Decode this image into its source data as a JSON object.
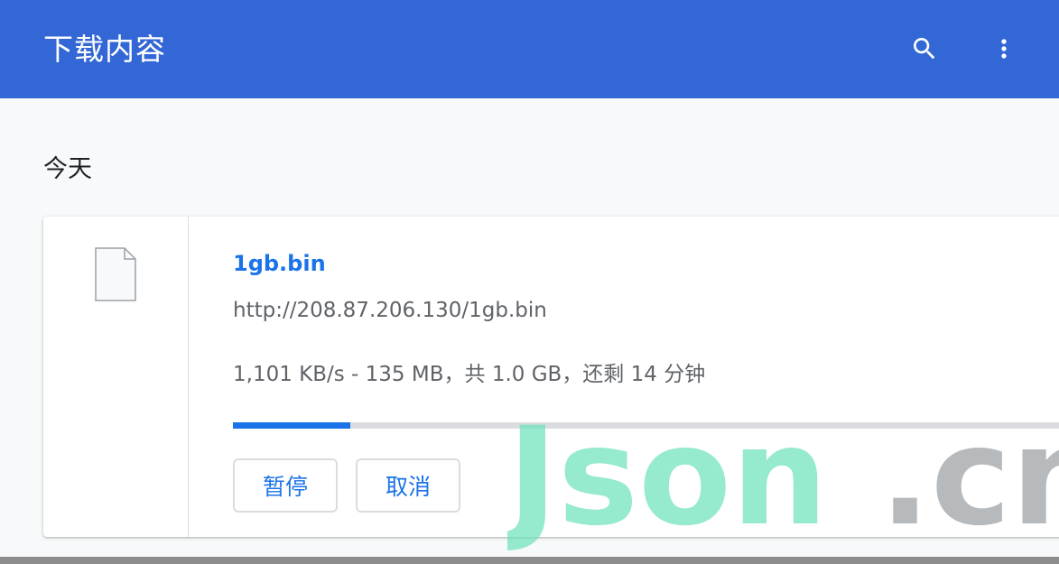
{
  "header": {
    "title": "下载内容",
    "search_icon": "search-icon",
    "more_icon": "more-vert-icon",
    "background_color": "#3367d6"
  },
  "section": {
    "date_label": "今天"
  },
  "download": {
    "file_icon": "file-icon",
    "file_name": "1gb.bin",
    "url": "http://208.87.206.130/1gb.bin",
    "status": "1,101 KB/s - 135 MB，共 1.0 GB，还剩 14 分钟",
    "progress_percent": 14,
    "pause_label": "暂停",
    "cancel_label": "取消",
    "accent_color": "#1a73e8"
  },
  "watermark": {
    "part1": "Json",
    "part2": ".cn"
  }
}
